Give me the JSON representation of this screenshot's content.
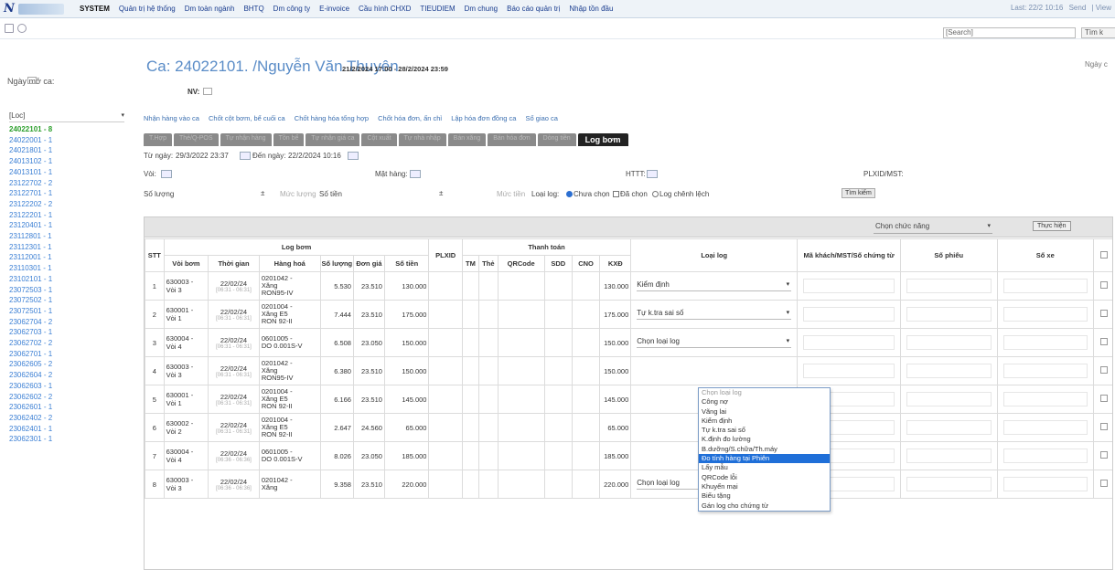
{
  "topbar": {
    "system": "SYSTEM",
    "menu": [
      "Quản trị hệ thống",
      "Dm toàn ngành",
      "BHTQ",
      "Dm công ty",
      "E-invoice",
      "Cầu hình CHXD",
      "TIEUDIEM",
      "Dm chung",
      "Báo cáo quản trị",
      "Nhập tồn đầu"
    ],
    "right": [
      "Last: 22/2 10:16",
      "Send",
      "| View"
    ]
  },
  "search": {
    "placeholder": "[Search]",
    "button": "Tìm k"
  },
  "sidebar": {
    "title": "Ngày mở ca:",
    "loc": "[Loc]",
    "items": [
      "24022101 - 8",
      "24022001 - 1",
      "24021801 - 1",
      "24013102 - 1",
      "24013101 - 1",
      "23122702 - 2",
      "23122701 - 1",
      "23122202 - 2",
      "23122201 - 1",
      "23120401 - 1",
      "23112801 - 1",
      "23112301 - 1",
      "23112001 - 1",
      "23110301 - 1",
      "23102101 - 1",
      "23072503 - 1",
      "23072502 - 1",
      "23072501 - 1",
      "23062704 - 2",
      "23062703 - 1",
      "23062702 - 2",
      "23062701 - 1",
      "23062605 - 2",
      "23062604 - 2",
      "23062603 - 1",
      "23062602 - 2",
      "23062601 - 1",
      "23062402 - 2",
      "23062401 - 1",
      "23062301 - 1"
    ]
  },
  "header": {
    "title": "Ca: 24022101. /Nguyễn Văn Thuyên",
    "date_range": "21/2/2024 17:00 - 28/2/2024 23:59",
    "nv": "NV:",
    "right_label": "Ngày c"
  },
  "links": [
    "Nhận hàng vào ca",
    "Chốt cột bơm, bể cuối ca",
    "Chốt hàng hóa tổng hợp",
    "Chốt hóa đơn, ấn chỉ",
    "Lập hóa đơn đồng ca",
    "Sổ giao ca"
  ],
  "tabs": [
    "T.Hợp",
    "Thẻ/Q-POS",
    "Tự nhận hàng",
    "Tồn bể",
    "Tự nhận giá ca",
    "Cột xuất",
    "Tự nhà nhập",
    "Bán xăng",
    "Bán hóa đơn",
    "Dòng tiền",
    "Log bơm"
  ],
  "filters": {
    "from_label": "Từ ngày:",
    "from_value": "29/3/2022 23:37",
    "to_label": "Đến ngày:",
    "to_value": "22/2/2024 10:16",
    "voi": "Vòi:",
    "mat_hang": "Mặt hàng:",
    "httt": "HTTT:",
    "plxid": "PLXID/MST:",
    "so_luong": "Số lượng",
    "muc_luong": "Mức lượng",
    "so_tien": "Số tiền",
    "muc_tien": "Mức tiền",
    "loai_log": "Loại log:",
    "radio_options": [
      "Chưa chọn",
      "Đã chọn",
      "Log chênh lệch"
    ],
    "search_btn": "Tìm kiếm"
  },
  "table": {
    "function_select": "Chọn chức năng",
    "exec_btn": "Thực hiện",
    "group_log_bom": "Log bơm",
    "group_thanh_toan": "Thanh toán",
    "headers": [
      "STT",
      "Vòi bơm",
      "Thời gian",
      "Hàng hoá",
      "Số lượng",
      "Đơn giá",
      "Số tiền",
      "PLXID",
      "TM",
      "Thẻ",
      "QRCode",
      "SDD",
      "CNO",
      "KXĐ",
      "Loại log",
      "Mã khách/MST/Số chứng từ",
      "Số phiếu",
      "Số xe"
    ],
    "rows": [
      {
        "stt": "1",
        "pump_code": "630003 -",
        "pump_name": "Vòi 3",
        "date": "22/02/24",
        "time": "[06:31 - 06:31]",
        "goods": [
          "0201042 -",
          "Xăng",
          "RON95-IV"
        ],
        "qty": "5.530",
        "price": "23.510",
        "amount": "130.000",
        "kxd": "130.000",
        "log": "Kiểm định"
      },
      {
        "stt": "2",
        "pump_code": "630001 -",
        "pump_name": "Vòi 1",
        "date": "22/02/24",
        "time": "[06:31 - 06:31]",
        "goods": [
          "0201004 -",
          "Xăng E5",
          "RON 92-II"
        ],
        "qty": "7.444",
        "price": "23.510",
        "amount": "175.000",
        "kxd": "175.000",
        "log": "Tự k.tra sai số"
      },
      {
        "stt": "3",
        "pump_code": "630004 -",
        "pump_name": "Vòi 4",
        "date": "22/02/24",
        "time": "[06:31 - 06:31]",
        "goods": [
          "0601005 -",
          "DO 0.001S-V"
        ],
        "qty": "6.508",
        "price": "23.050",
        "amount": "150.000",
        "kxd": "150.000",
        "log": "Chọn loại log"
      },
      {
        "stt": "4",
        "pump_code": "630003 -",
        "pump_name": "Vòi 3",
        "date": "22/02/24",
        "time": "[06:31 - 06:31]",
        "goods": [
          "0201042 -",
          "Xăng",
          "RON95-IV"
        ],
        "qty": "6.380",
        "price": "23.510",
        "amount": "150.000",
        "kxd": "150.000",
        "log": ""
      },
      {
        "stt": "5",
        "pump_code": "630001 -",
        "pump_name": "Vòi 1",
        "date": "22/02/24",
        "time": "[06:31 - 06:31]",
        "goods": [
          "0201004 -",
          "Xăng E5",
          "RON 92-II"
        ],
        "qty": "6.166",
        "price": "23.510",
        "amount": "145.000",
        "kxd": "145.000",
        "log": ""
      },
      {
        "stt": "6",
        "pump_code": "630002 -",
        "pump_name": "Vòi 2",
        "date": "22/02/24",
        "time": "[06:31 - 06:31]",
        "goods": [
          "0201004 -",
          "Xăng E5",
          "RON 92-II"
        ],
        "qty": "2.647",
        "price": "24.560",
        "amount": "65.000",
        "kxd": "65.000",
        "log": ""
      },
      {
        "stt": "7",
        "pump_code": "630004 -",
        "pump_name": "Vòi 4",
        "date": "22/02/24",
        "time": "[06:36 - 06:36]",
        "goods": [
          "0601005 -",
          "DO 0.001S-V"
        ],
        "qty": "8.026",
        "price": "23.050",
        "amount": "185.000",
        "kxd": "185.000",
        "log": ""
      },
      {
        "stt": "8",
        "pump_code": "630003 -",
        "pump_name": "Vòi 3",
        "date": "22/02/24",
        "time": "[06:36 - 06:36]",
        "goods": [
          "0201042 -",
          "Xăng"
        ],
        "qty": "9.358",
        "price": "23.510",
        "amount": "220.000",
        "kxd": "220.000",
        "log": "Chọn loại log"
      }
    ]
  },
  "dropdown": {
    "options": [
      "Chọn loại log",
      "Công nợ",
      "Vãng lai",
      "Kiểm định",
      "Tự k.tra sai số",
      "K.định đo lường",
      "B.dưỡng/S.chữa/Th.máy",
      "Đo tính hàng tại Phiên",
      "Lấy mẫu",
      "QRCode lỗi",
      "Khuyến mại",
      "Biếu tặng",
      "Gán log cho chứng từ"
    ],
    "highlighted_index": 7
  }
}
